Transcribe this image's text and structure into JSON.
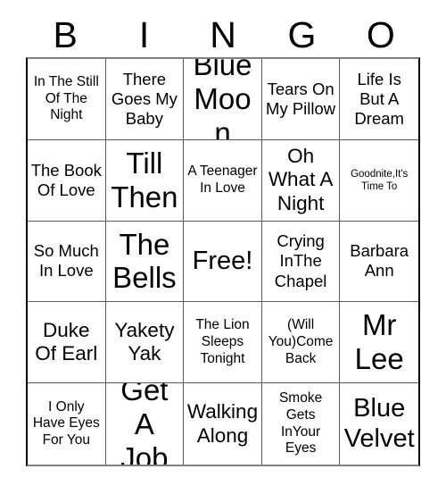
{
  "card": {
    "title": "BINGO",
    "header_letters": [
      "B",
      "I",
      "N",
      "G",
      "O"
    ],
    "columns": 5,
    "rows": 5,
    "free_space": {
      "row": 3,
      "column": 3,
      "label": "Free!"
    },
    "colors": {
      "background": "#FFFFFF",
      "text": "#000000",
      "grid_line": "#5A5A5A",
      "outer_border": "#000000"
    },
    "cells": [
      {
        "id": "b1",
        "row": 1,
        "column": 1,
        "letter": "B",
        "text": "In The Still Of The Night",
        "size": "small"
      },
      {
        "id": "i1",
        "row": 1,
        "column": 2,
        "letter": "I",
        "text": "There Goes My Baby",
        "size": "medium"
      },
      {
        "id": "n1",
        "row": 1,
        "column": 3,
        "letter": "N",
        "text": "Blue Moon",
        "size": "huge"
      },
      {
        "id": "g1",
        "row": 1,
        "column": 4,
        "letter": "G",
        "text": "Tears On My Pillow",
        "size": "medium"
      },
      {
        "id": "o1",
        "row": 1,
        "column": 5,
        "letter": "O",
        "text": "Life Is But A Dream",
        "size": "medium"
      },
      {
        "id": "b2",
        "row": 2,
        "column": 1,
        "letter": "B",
        "text": "The Book Of Love",
        "size": "medium"
      },
      {
        "id": "i2",
        "row": 2,
        "column": 2,
        "letter": "I",
        "text": "Till Then",
        "size": "huge"
      },
      {
        "id": "n2",
        "row": 2,
        "column": 3,
        "letter": "N",
        "text": "A Teenager In Love",
        "size": "small"
      },
      {
        "id": "g2",
        "row": 2,
        "column": 4,
        "letter": "G",
        "text": "Oh What A Night",
        "size": "large"
      },
      {
        "id": "o2",
        "row": 2,
        "column": 5,
        "letter": "O",
        "text": "Goodnite,It's Time To",
        "size": "xsmall"
      },
      {
        "id": "b3",
        "row": 3,
        "column": 1,
        "letter": "B",
        "text": "So Much In Love",
        "size": "medium"
      },
      {
        "id": "i3",
        "row": 3,
        "column": 2,
        "letter": "I",
        "text": "The Bells",
        "size": "huge"
      },
      {
        "id": "n3",
        "row": 3,
        "column": 3,
        "letter": "N",
        "text": "Free!",
        "size": "xlarge"
      },
      {
        "id": "g3",
        "row": 3,
        "column": 4,
        "letter": "G",
        "text": "Crying InThe Chapel",
        "size": "medium"
      },
      {
        "id": "o3",
        "row": 3,
        "column": 5,
        "letter": "O",
        "text": "Barbara Ann",
        "size": "medium"
      },
      {
        "id": "b4",
        "row": 4,
        "column": 1,
        "letter": "B",
        "text": "Duke Of Earl",
        "size": "large"
      },
      {
        "id": "i4",
        "row": 4,
        "column": 2,
        "letter": "I",
        "text": "Yakety Yak",
        "size": "large"
      },
      {
        "id": "n4",
        "row": 4,
        "column": 3,
        "letter": "N",
        "text": "The Lion Sleeps Tonight",
        "size": "small"
      },
      {
        "id": "g4",
        "row": 4,
        "column": 4,
        "letter": "G",
        "text": "(Will You)Come Back",
        "size": "small"
      },
      {
        "id": "o4",
        "row": 4,
        "column": 5,
        "letter": "O",
        "text": "Mr Lee",
        "size": "huge"
      },
      {
        "id": "b5",
        "row": 5,
        "column": 1,
        "letter": "B",
        "text": "I Only Have Eyes For You",
        "size": "small"
      },
      {
        "id": "i5",
        "row": 5,
        "column": 2,
        "letter": "I",
        "text": "Get A Job",
        "size": "huge"
      },
      {
        "id": "n5",
        "row": 5,
        "column": 3,
        "letter": "N",
        "text": "Walking Along",
        "size": "large"
      },
      {
        "id": "g5",
        "row": 5,
        "column": 4,
        "letter": "G",
        "text": "Smoke Gets InYour Eyes",
        "size": "small"
      },
      {
        "id": "o5",
        "row": 5,
        "column": 5,
        "letter": "O",
        "text": "Blue Velvet",
        "size": "xlarge"
      }
    ]
  }
}
